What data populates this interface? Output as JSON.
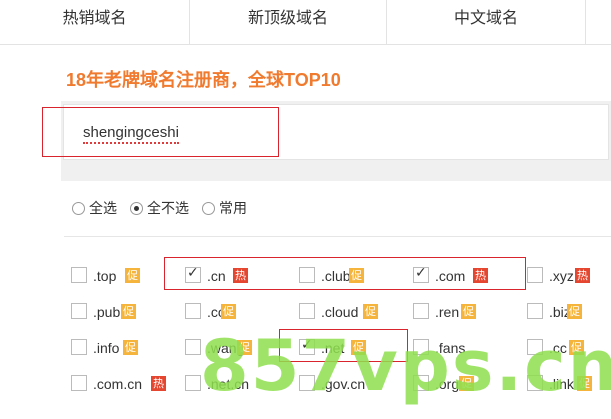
{
  "tabs": [
    {
      "label": "热销域名"
    },
    {
      "label": "新顶级域名"
    },
    {
      "label": "中文域名"
    }
  ],
  "headline": "18年老牌域名注册商，全球TOP10",
  "search": {
    "value": "shengingceshi"
  },
  "select_mode": [
    {
      "label": "全选",
      "selected": false
    },
    {
      "label": "全不选",
      "selected": true
    },
    {
      "label": "常用",
      "selected": false
    }
  ],
  "badge_legend": {
    "hot": "热",
    "promo": "促"
  },
  "domains": [
    [
      {
        "name": ".top",
        "checked": false,
        "badge": "促",
        "badge_type": "promo"
      },
      {
        "name": ".cn",
        "checked": true,
        "badge": "热",
        "badge_type": "hot"
      },
      {
        "name": ".club",
        "checked": false,
        "badge": "促",
        "badge_type": "promo"
      },
      {
        "name": ".com",
        "checked": true,
        "badge": "热",
        "badge_type": "hot"
      },
      {
        "name": ".xyz",
        "checked": false,
        "badge": "热",
        "badge_type": "hot"
      }
    ],
    [
      {
        "name": ".pub",
        "checked": false,
        "badge": "促",
        "badge_type": "promo"
      },
      {
        "name": ".co",
        "checked": false,
        "badge": "促",
        "badge_type": "promo"
      },
      {
        "name": ".cloud",
        "checked": false,
        "badge": "促",
        "badge_type": "promo"
      },
      {
        "name": ".ren",
        "checked": false,
        "badge": "促",
        "badge_type": "promo"
      },
      {
        "name": ".biz",
        "checked": false,
        "badge": "促",
        "badge_type": "promo"
      }
    ],
    [
      {
        "name": ".info",
        "checked": false,
        "badge": "促",
        "badge_type": "promo"
      },
      {
        "name": ".wang",
        "checked": false,
        "badge": "促",
        "badge_type": "promo"
      },
      {
        "name": ".net",
        "checked": true,
        "badge": "促",
        "badge_type": "promo"
      },
      {
        "name": ".fans",
        "checked": false,
        "badge": "",
        "badge_type": ""
      },
      {
        "name": ".cc",
        "checked": false,
        "badge": "促",
        "badge_type": "promo"
      }
    ],
    [
      {
        "name": ".com.cn",
        "checked": false,
        "badge": "热",
        "badge_type": "hot"
      },
      {
        "name": ".net.cn",
        "checked": false,
        "badge": "",
        "badge_type": ""
      },
      {
        "name": ".gov.cn",
        "checked": false,
        "badge": "",
        "badge_type": ""
      },
      {
        "name": ".org",
        "checked": false,
        "badge": "促",
        "badge_type": "promo"
      },
      {
        "name": ".link",
        "checked": false,
        "badge": "促",
        "badge_type": "promo"
      }
    ]
  ],
  "watermark": "857vps.cn",
  "colors": {
    "headline": "#f07a2e",
    "hot_badge": "#e4462f",
    "promo_badge": "#f5b43c",
    "highlight_box": "#d9232d",
    "watermark": "#8fe04e"
  }
}
